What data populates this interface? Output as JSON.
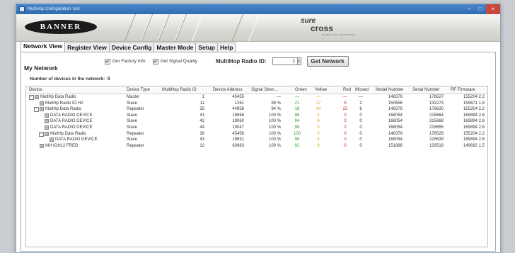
{
  "window": {
    "title": "MultiHop Configuration Tool"
  },
  "banner": {
    "logo_text": "BANNER",
    "brand_sure": "sure",
    "brand_cross": "cross",
    "brand_sub": "WIRELESS NETWORK"
  },
  "tabs": [
    "Network View",
    "Register View",
    "Device Config",
    "Master Mode",
    "Setup",
    "Help"
  ],
  "options": {
    "factory_info_label": "Get Factory Info",
    "signal_quality_label": "Get Signal Quality",
    "radio_id_label": "MultiHop Radio ID:",
    "radio_id_value": "1",
    "get_network_label": "Get Network"
  },
  "network": {
    "section_title": "My Network",
    "count_label": "Number of devices in the network:",
    "count_value": "9"
  },
  "table": {
    "columns": [
      "Device",
      "Device Type",
      "MultiHop Radio ID",
      "Device Address",
      "Signal Stren...",
      "Green",
      "Yellow",
      "Red",
      "Missed",
      "Model Number",
      "Serial Number",
      "RF Firmware"
    ],
    "rows": [
      {
        "device": "MultHp Data  Radio",
        "type": "Master",
        "radio_id": "1",
        "address": "45455",
        "signal": "—",
        "green": "—",
        "yellow": "—",
        "red": "—",
        "missed": "—",
        "model": "148376",
        "serial": "176527",
        "fw": "155204 2.2"
      },
      {
        "device": "MultHp Radio IO H2",
        "type": "Slave",
        "radio_id": "11",
        "address": "1261",
        "signal": "98 %",
        "green": "21",
        "yellow": "17",
        "red": "5",
        "missed": "2",
        "model": "150656",
        "serial": "132273",
        "fw": "159671 1.6"
      },
      {
        "device": "MultHp Data  Radio",
        "type": "Repeater",
        "radio_id": "25",
        "address": "44958",
        "signal": "94 %",
        "green": "18",
        "yellow": "14",
        "red": "22",
        "missed": "6",
        "model": "148376",
        "serial": "176630",
        "fw": "155204 2.2"
      },
      {
        "device": "DATA  RADIO DEVICE",
        "type": "Slave",
        "radio_id": "41",
        "address": "19656",
        "signal": "100 %",
        "green": "96",
        "yellow": "4",
        "red": "0",
        "missed": "0",
        "model": "168054",
        "serial": "215664",
        "fw": "169894 2.6"
      },
      {
        "device": "DATA  RADIO DEVICE",
        "type": "Slave",
        "radio_id": "42",
        "address": "19060",
        "signal": "100 %",
        "green": "94",
        "yellow": "6",
        "red": "0",
        "missed": "0",
        "model": "168054",
        "serial": "215668",
        "fw": "169894 2.6"
      },
      {
        "device": "DATA  RADIO DEVICE",
        "type": "Slave",
        "radio_id": "44",
        "address": "19047",
        "signal": "100 %",
        "green": "98",
        "yellow": "0",
        "red": "2",
        "missed": "0",
        "model": "168054",
        "serial": "215655",
        "fw": "169894 2.6"
      },
      {
        "device": "MultHp Data  Radio",
        "type": "Repeater",
        "radio_id": "26",
        "address": "45456",
        "signal": "100 %",
        "green": "100",
        "yellow": "0",
        "red": "0",
        "missed": "0",
        "model": "148376",
        "serial": "176528",
        "fw": "155204 2.2"
      },
      {
        "device": "DATA  RADIO DEVICE",
        "type": "Slave",
        "radio_id": "43",
        "address": "19631",
        "signal": "100 %",
        "green": "96",
        "yellow": "4",
        "red": "0",
        "missed": "0",
        "model": "168054",
        "serial": "215639",
        "fw": "169894 2.6"
      },
      {
        "device": "MH IOH12 FRED",
        "type": "Repeater",
        "radio_id": "12",
        "address": "63983",
        "signal": "100 %",
        "green": "92",
        "yellow": "8",
        "red": "0",
        "missed": "0",
        "model": "151686",
        "serial": "129519",
        "fw": "149692 1.5"
      }
    ]
  },
  "colors": {
    "green": "#2e9a2e",
    "yellow": "#e0a020",
    "red": "#d02020",
    "titlebar": "#2f6bb2"
  }
}
